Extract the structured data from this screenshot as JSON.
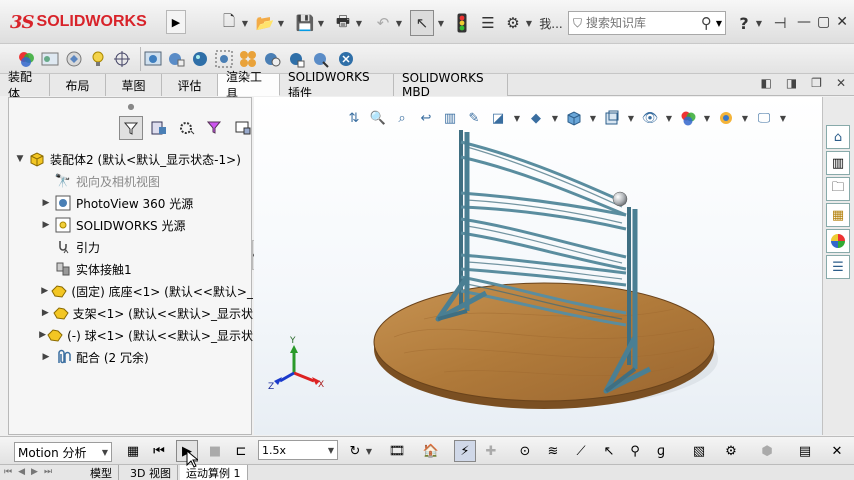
{
  "app": {
    "logo_ds": "3S",
    "logo_text": "SOLIDWORKS",
    "search_placeholder": "搜索知识库",
    "menu_partial": "我..."
  },
  "command_tabs": [
    "装配体",
    "布局",
    "草图",
    "评估",
    "渲染工具",
    "SOLIDWORKS 插件",
    "SOLIDWORKS MBD"
  ],
  "active_command_tab": "渲染工具",
  "feature_tree": {
    "root_label": "装配体2  (默认<默认_显示状态-1>)",
    "items": [
      {
        "label": "视向及相机视图",
        "expandable": false,
        "muted": true
      },
      {
        "label": "PhotoView 360 光源",
        "expandable": true,
        "muted": false
      },
      {
        "label": "SOLIDWORKS 光源",
        "expandable": true,
        "muted": false
      },
      {
        "label": "引力",
        "expandable": false,
        "muted": false
      },
      {
        "label": "实体接触1",
        "expandable": false,
        "muted": false
      },
      {
        "label": "(固定) 底座<1> (默认<<默认>_",
        "expandable": true,
        "muted": false
      },
      {
        "label": "支架<1> (默认<<默认>_显示状",
        "expandable": true,
        "muted": false
      },
      {
        "label": "(-) 球<1> (默认<<默认>_显示状",
        "expandable": true,
        "muted": false
      },
      {
        "label": "配合 (2 冗余)",
        "expandable": true,
        "muted": false
      }
    ]
  },
  "motion": {
    "study_type": "Motion 分析",
    "playback_speed": "1.5x"
  },
  "bottom_tabs": [
    "模型",
    "3D 视图",
    "运动算例 1"
  ],
  "active_bottom_tab": "运动算例 1",
  "triad": {
    "x": "X",
    "y": "Y",
    "z": "Z"
  },
  "colors": {
    "logo_red": "#d8232a",
    "wood": "#b07a3a",
    "frame_steel": "#4a7f93"
  }
}
